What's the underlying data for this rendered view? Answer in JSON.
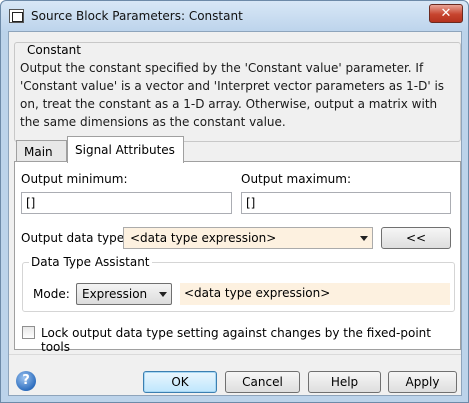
{
  "window": {
    "title": "Source Block Parameters: Constant",
    "close_glyph": "✕"
  },
  "block": {
    "group_title": "Constant",
    "description": "Output the constant specified by the 'Constant value' parameter. If 'Constant value' is a vector and 'Interpret vector parameters as 1-D' is on, treat the constant as a 1-D array. Otherwise, output a matrix with the same dimensions as the constant value."
  },
  "tabs": [
    {
      "label": "Main",
      "selected": false
    },
    {
      "label": "Signal Attributes",
      "selected": true
    }
  ],
  "signal_attributes": {
    "output_min_label": "Output minimum:",
    "output_min_value": "[]",
    "output_max_label": "Output maximum:",
    "output_max_value": "[]",
    "data_type_label": "Output data type:",
    "data_type_value": "<data type expression>",
    "assistant_toggle_label": "<<",
    "assistant": {
      "title": "Data Type Assistant",
      "mode_label": "Mode:",
      "mode_value": "Expression",
      "expression_value": "<data type expression>"
    },
    "lock_checkbox_label": "Lock output data type setting against changes by the fixed-point tools",
    "lock_checked": false
  },
  "footer": {
    "help_icon_glyph": "?",
    "ok_label": "OK",
    "cancel_label": "Cancel",
    "help_label": "Help",
    "apply_label": "Apply"
  },
  "colors": {
    "titlebar": "#bdd4ec",
    "close_button": "#c7442f",
    "expression_field_bg": "#fdf1e0",
    "default_button_border": "#3c7fb1"
  }
}
